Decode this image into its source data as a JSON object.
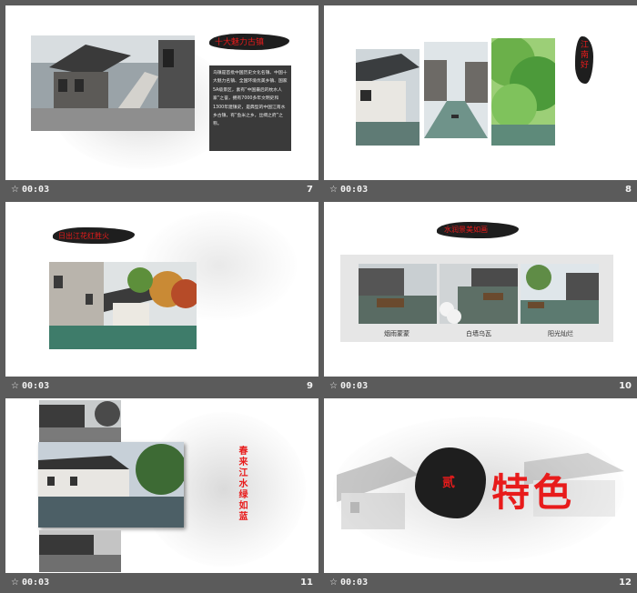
{
  "slides": [
    {
      "time": "00:03",
      "number": "7",
      "title": "十大魅力古镇",
      "body": "乌镇是首批中国历史文化名镇、中国十大魅力名镇、全国环境优美乡镇、国家5A级景区，素有“中国最后的枕水人家”之誉，拥有7000多年文明史和1300年建镇史，是典型的中国江南水乡古镇，有“鱼米之乡，丝绸之府”之称。"
    },
    {
      "time": "00:03",
      "number": "8",
      "title": "江南好"
    },
    {
      "time": "00:03",
      "number": "9",
      "title": "日出江花红胜火"
    },
    {
      "time": "00:03",
      "number": "10",
      "title": "水润景美如画",
      "captions": [
        "烟雨蒙蒙",
        "白墙乌瓦",
        "阳光灿烂"
      ]
    },
    {
      "time": "00:03",
      "number": "11",
      "title": "春来江水绿如蓝"
    },
    {
      "time": "00:03",
      "number": "12",
      "badge": "贰",
      "title": "特色"
    }
  ],
  "icons": {
    "play": "play-marker-icon"
  }
}
